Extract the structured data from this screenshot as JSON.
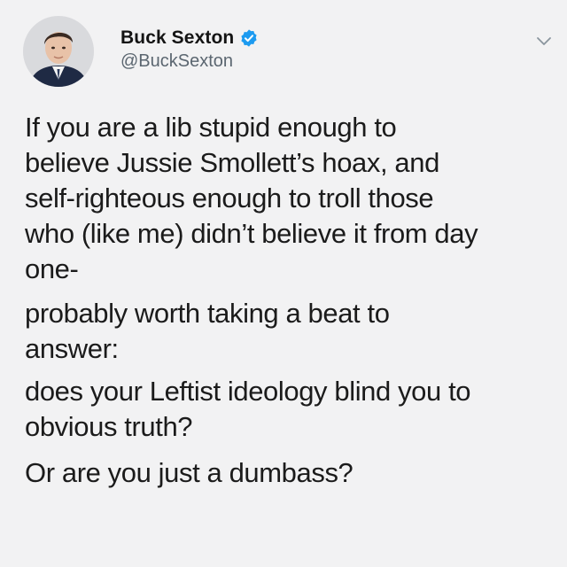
{
  "tweet": {
    "author": {
      "display_name": "Buck Sexton",
      "handle": "@BuckSexton",
      "verified": true,
      "verified_color": "#1d9bf0"
    },
    "menu_icon": "chevron-down-icon",
    "paragraphs": [
      {
        "lines": [
          "If you are a lib stupid enough to",
          "believe Jussie Smollett’s hoax, and",
          "self-righteous enough to troll those",
          "who (like me) didn’t believe it from day",
          "one-"
        ]
      },
      {
        "lines": [
          "probably worth taking a beat to",
          "answer:"
        ]
      },
      {
        "lines": [
          "does your Leftist ideology blind you to",
          "obvious truth?"
        ]
      },
      {
        "lines": [
          "Or are you just a dumbass?"
        ]
      }
    ]
  }
}
